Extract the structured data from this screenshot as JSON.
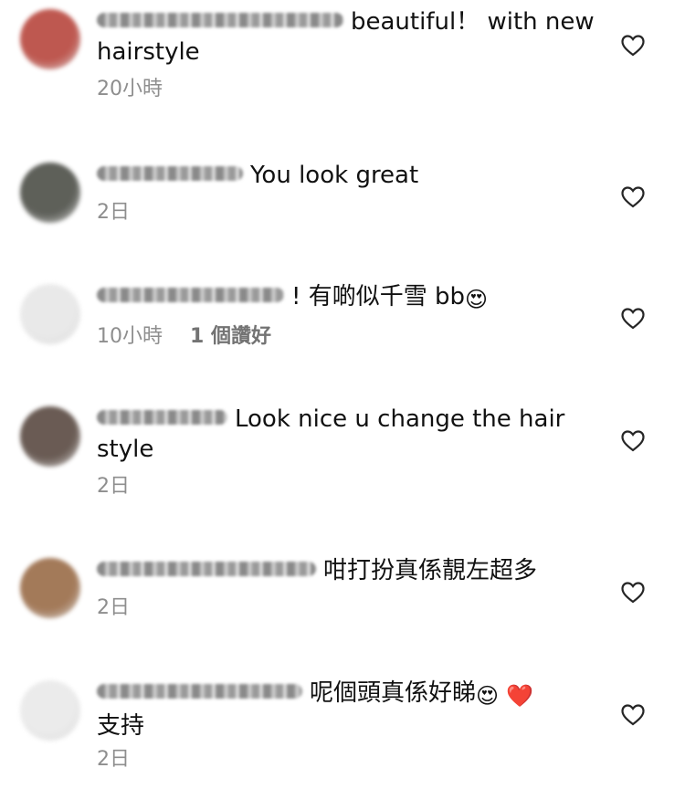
{
  "comments": [
    {
      "text": "beautiful！ with new hairstyle",
      "time": "20小時",
      "likes": "",
      "avatar_color": "#b8473e"
    },
    {
      "text": "You look great",
      "time": "2日",
      "likes": "",
      "avatar_color": "#4d4f48"
    },
    {
      "text": "! 有啲似千雪 bb",
      "emoji": "😍",
      "time": "10小時",
      "likes": "1 個讚好",
      "avatar_color": "#e7e7e7"
    },
    {
      "text": "Look nice u change the hair style",
      "time": "2日",
      "likes": "",
      "avatar_color": "#5a4a42"
    },
    {
      "text": "咁打扮真係靚左超多",
      "time": "2日",
      "likes": "",
      "avatar_color": "#9a6c48"
    },
    {
      "text": "呢個頭真係好睇",
      "emoji": "😍",
      "emoji2": "❤️",
      "text2": "支持",
      "time": "2日",
      "likes": "",
      "avatar_color": "#e9e9e9"
    }
  ]
}
